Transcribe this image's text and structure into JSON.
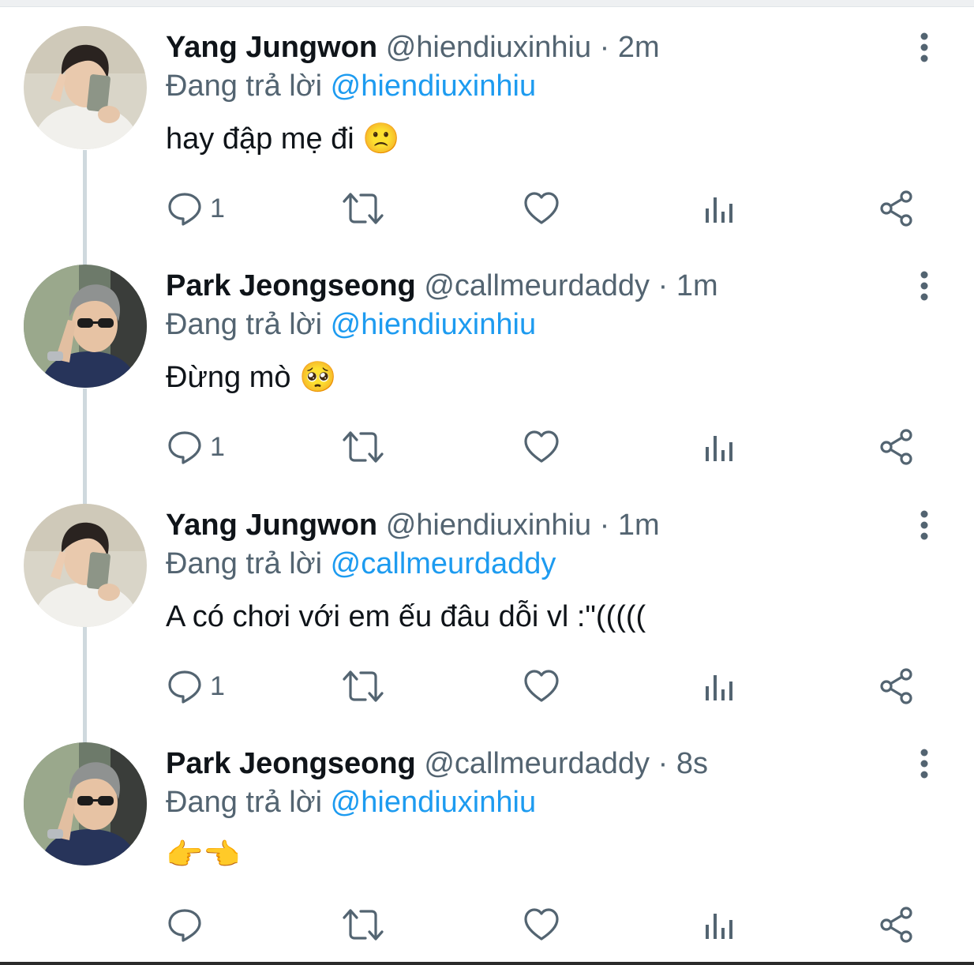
{
  "thread": [
    {
      "display_name": "Yang Jungwon",
      "handle": "@hiendiuxinhiu",
      "separator": "·",
      "time": "2m",
      "reply_prefix": "Đang trả lời",
      "reply_to": "@hiendiuxinhiu",
      "text": "hay đập mẹ đi 🙁",
      "reply_count": "1",
      "avatar": "jungwon"
    },
    {
      "display_name": "Park Jeongseong",
      "handle": "@callmeurdaddy",
      "separator": "·",
      "time": "1m",
      "reply_prefix": "Đang trả lời",
      "reply_to": "@hiendiuxinhiu",
      "text": "Đừng mò 🥺",
      "reply_count": "1",
      "avatar": "jeongseong"
    },
    {
      "display_name": "Yang Jungwon",
      "handle": "@hiendiuxinhiu",
      "separator": "·",
      "time": "1m",
      "reply_prefix": "Đang trả lời",
      "reply_to": "@callmeurdaddy",
      "text": "A có chơi với em ếu đâu dỗi vl :\"(((((",
      "reply_count": "1",
      "avatar": "jungwon"
    },
    {
      "display_name": "Park Jeongseong",
      "handle": "@callmeurdaddy",
      "separator": "·",
      "time": "8s",
      "reply_prefix": "Đang trả lời",
      "reply_to": "@hiendiuxinhiu",
      "text": "👉👈",
      "reply_count": "",
      "avatar": "jeongseong"
    }
  ],
  "icons": {
    "reply": "speech-bubble-icon",
    "retweet": "retweet-icon",
    "like": "heart-icon",
    "views": "bar-chart-icon",
    "share": "share-icon",
    "more": "vertical-ellipsis-icon"
  },
  "colors": {
    "text": "#0f1419",
    "secondary": "#536471",
    "link": "#1d9bf0",
    "thread_line": "#cfd9de"
  }
}
